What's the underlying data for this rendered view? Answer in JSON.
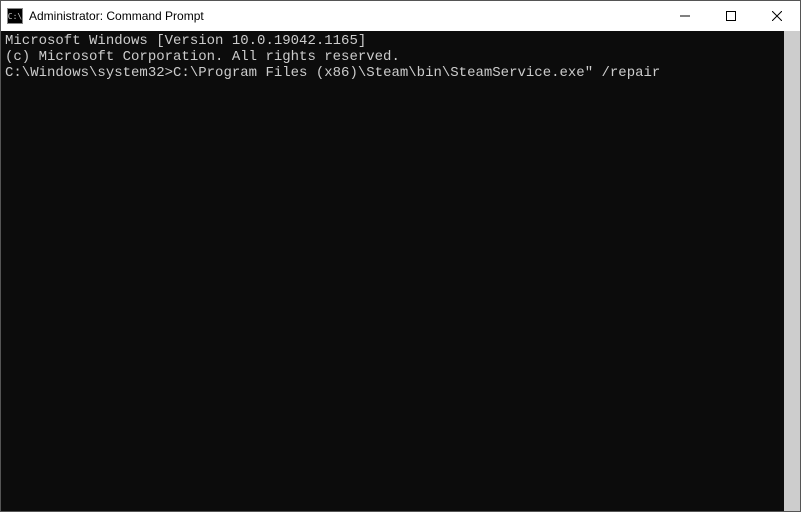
{
  "window": {
    "title": "Administrator: Command Prompt"
  },
  "terminal": {
    "line1": "Microsoft Windows [Version 10.0.19042.1165]",
    "line2": "(c) Microsoft Corporation. All rights reserved.",
    "blank": "",
    "prompt": "C:\\Windows\\system32>",
    "command": "C:\\Program Files (x86)\\Steam\\bin\\SteamService.exe\" /repair"
  },
  "icon_label": "C:\\"
}
